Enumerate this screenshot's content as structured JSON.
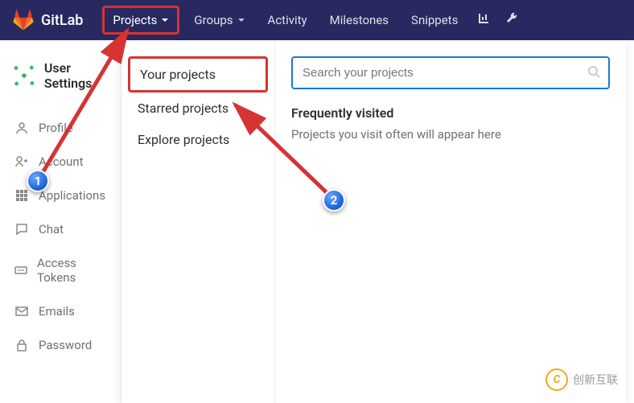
{
  "navbar": {
    "brand": "GitLab",
    "items": [
      {
        "label": "Projects",
        "hasDropdown": true
      },
      {
        "label": "Groups",
        "hasDropdown": true
      },
      {
        "label": "Activity"
      },
      {
        "label": "Milestones"
      },
      {
        "label": "Snippets"
      }
    ]
  },
  "sidebar": {
    "title": "User Settings",
    "items": [
      {
        "icon": "user-icon",
        "label": "Profile"
      },
      {
        "icon": "account-icon",
        "label": "Account"
      },
      {
        "icon": "apps-icon",
        "label": "Applications"
      },
      {
        "icon": "chat-icon",
        "label": "Chat"
      },
      {
        "icon": "token-icon",
        "label": "Access Tokens"
      },
      {
        "icon": "mail-icon",
        "label": "Emails"
      },
      {
        "icon": "lock-icon",
        "label": "Password"
      }
    ]
  },
  "dropdown": {
    "items": [
      {
        "label": "Your projects"
      },
      {
        "label": "Starred projects"
      },
      {
        "label": "Explore projects"
      }
    ],
    "search_placeholder": "Search your projects",
    "frequently_title": "Frequently visited",
    "frequently_text": "Projects you visit often will appear here"
  },
  "annotations": {
    "badge1": "1",
    "badge2": "2"
  },
  "watermark": {
    "text": "创新互联"
  }
}
